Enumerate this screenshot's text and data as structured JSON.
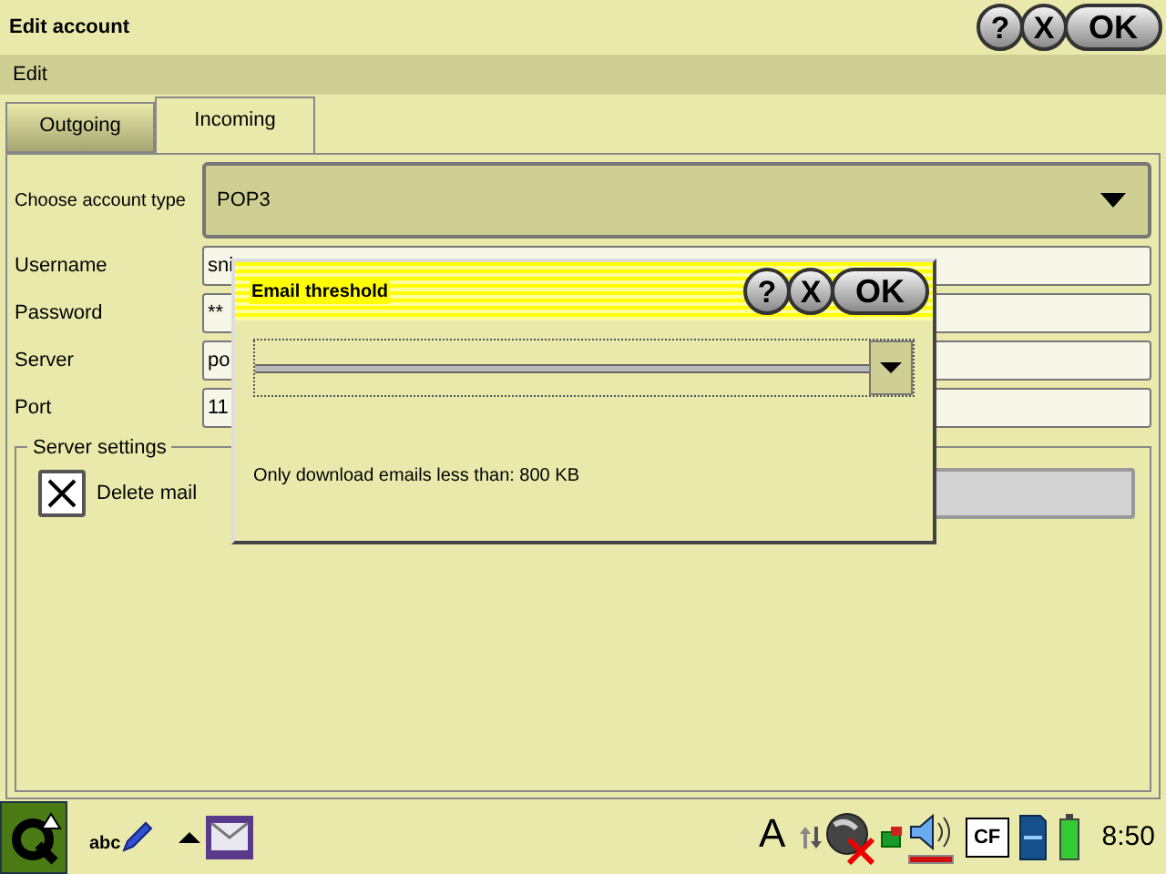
{
  "window": {
    "title": "Edit account",
    "buttons": [
      {
        "kind": "help",
        "label": "?"
      },
      {
        "kind": "close",
        "label": "X"
      },
      {
        "kind": "ok",
        "label": "OK"
      }
    ]
  },
  "menu": [
    "Edit"
  ],
  "tabs": [
    {
      "label": "Outgoing",
      "selected": false
    },
    {
      "label": "Incoming",
      "selected": true
    }
  ],
  "account_type": {
    "label": "Choose account type",
    "value": "POP3"
  },
  "fields": [
    {
      "label": "Username",
      "value": "sni"
    },
    {
      "label": "Password",
      "value": "**"
    },
    {
      "label": "Server",
      "value": "po"
    },
    {
      "label": "Port",
      "value": "11"
    }
  ],
  "server_settings": {
    "title": "Server settings",
    "delete_mail": {
      "label": "Delete mail",
      "checked": true
    }
  },
  "dialog": {
    "title": "Email threshold",
    "slider": {
      "level": 1
    },
    "buttons": [
      {
        "kind": "help",
        "label": "?"
      },
      {
        "kind": "close",
        "label": "X"
      },
      {
        "kind": "ok",
        "label": "OK"
      }
    ],
    "message": "Only download emails less than: 800 KB"
  },
  "taskbar": {
    "input_method": "abc",
    "font_label": "A",
    "card_label": "CF",
    "clock": "8:50"
  }
}
